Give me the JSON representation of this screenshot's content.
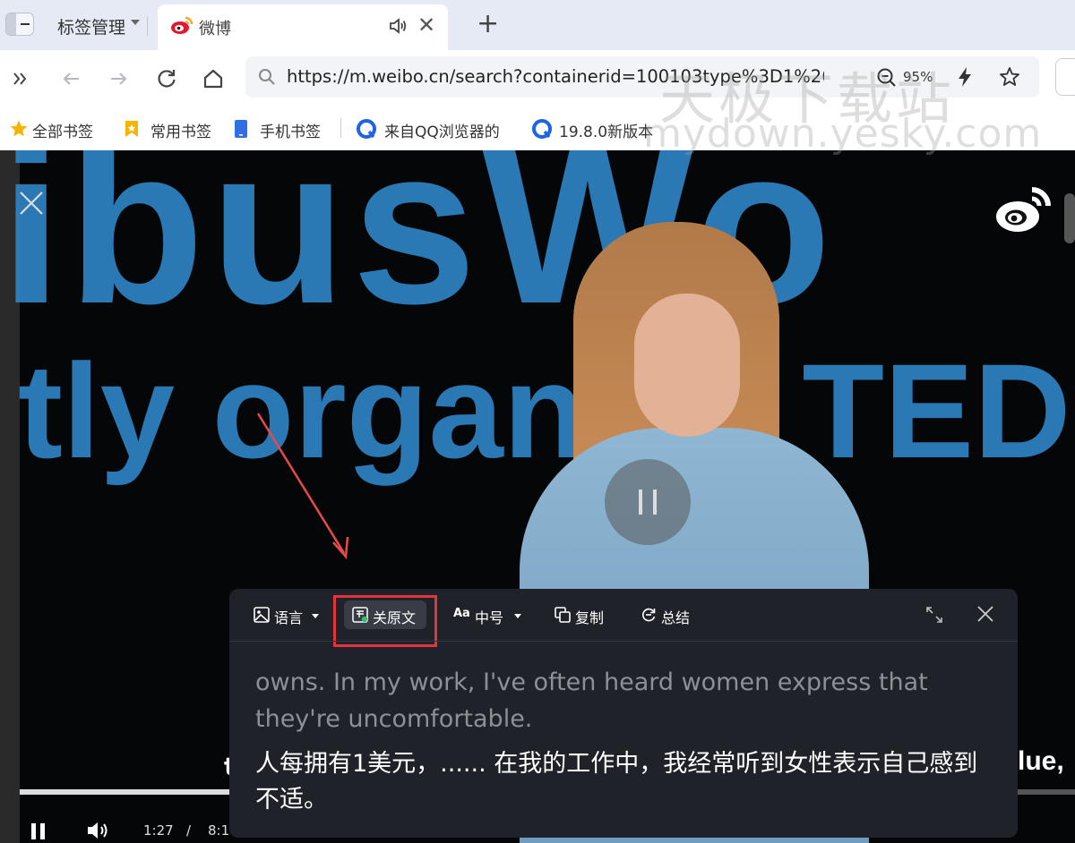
{
  "browser": {
    "tab_manager_label": "标签管理",
    "active_tab_title": "微博",
    "url": "https://m.weibo.cn/search?containerid=100103type%3D1%26",
    "zoom": "95%"
  },
  "bookmarks": [
    {
      "label": "全部书签",
      "icon": "star-icon"
    },
    {
      "label": "常用书签",
      "icon": "bookmark-icon"
    },
    {
      "label": "手机书签",
      "icon": "phone-icon"
    },
    {
      "label": "来自QQ浏览器的",
      "icon": "qq-browser-icon"
    },
    {
      "label": "19.8.0新版本",
      "icon": "qq-browser-icon"
    }
  ],
  "watermark": {
    "line1": "天极下载站",
    "line2": "mydown.yesky.com"
  },
  "video": {
    "bg_text_line1": "ibusWo",
    "bg_text_line2": "tly organiz | TED",
    "subtitle_left": "t",
    "subtitle_right": "lue,",
    "current_time": "1:27",
    "time_separator": "/",
    "total_time": "8:1",
    "progress_fraction": 0.2
  },
  "translation_panel": {
    "tools": {
      "language": "语言",
      "original_toggle": "关原文",
      "font_size": "中号",
      "copy": "复制",
      "summary": "总结"
    },
    "original_text": "owns. In my work, I've often heard women express that they're uncomfortable.",
    "translated_text": "人每拥有1美元，...... 在我的工作中，我经常听到女性表示自己感到不适。"
  },
  "colors": {
    "highlight_box": "#e5333c",
    "panel_bg": "#1f2228",
    "tab_bar_bg": "#e6eaf4",
    "ted_blue": "#2f86c8"
  }
}
